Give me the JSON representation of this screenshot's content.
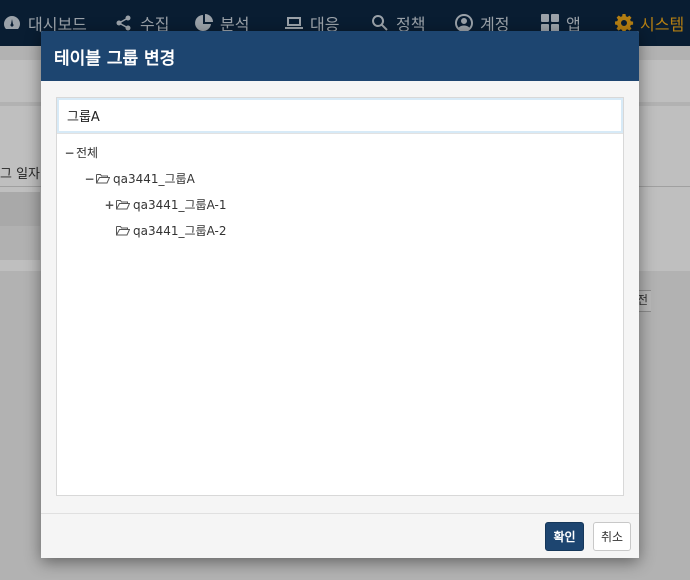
{
  "nav": {
    "items": [
      {
        "label": "대시보드",
        "icon": "dashboard-icon"
      },
      {
        "label": "수집",
        "icon": "share-icon"
      },
      {
        "label": "분석",
        "icon": "pie-chart-icon"
      },
      {
        "label": "대응",
        "icon": "laptop-icon"
      },
      {
        "label": "정책",
        "icon": "search-icon"
      },
      {
        "label": "계정",
        "icon": "user-icon"
      },
      {
        "label": "앱",
        "icon": "grid-icon"
      },
      {
        "label": "시스템",
        "icon": "gear-icon"
      }
    ],
    "active": "시스템",
    "active_color": "#f0a818",
    "bar_color": "#0c2743"
  },
  "background": {
    "table_header_fragment": "그 일자",
    "button_fragment": "전"
  },
  "modal": {
    "title": "테이블 그룹 변경",
    "header_color": "#1d4570",
    "search": {
      "value": "그룹A"
    },
    "tree": [
      {
        "label": "전체",
        "toggle": "−",
        "folder": false
      },
      {
        "label": "qa3441_그룹A",
        "toggle": "−",
        "folder": true
      },
      {
        "label": "qa3441_그룹A-1",
        "toggle": "+",
        "folder": true
      },
      {
        "label": "qa3441_그룹A-2",
        "toggle": "",
        "folder": true
      }
    ],
    "buttons": {
      "confirm": "확인",
      "cancel": "취소"
    }
  }
}
